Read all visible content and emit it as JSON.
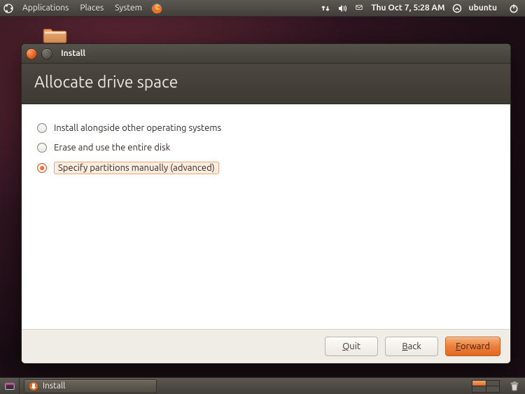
{
  "top_panel": {
    "menus": [
      "Applications",
      "Places",
      "System"
    ],
    "clock": "Thu Oct  7,  5:28 AM",
    "user": "ubuntu"
  },
  "window": {
    "title": "Install",
    "heading": "Allocate drive space",
    "options": [
      {
        "label": "Install alongside other operating systems",
        "checked": false
      },
      {
        "label": "Erase and use the entire disk",
        "checked": false
      },
      {
        "label": "Specify partitions manually (advanced)",
        "checked": true
      }
    ],
    "buttons": {
      "quit": "Quit",
      "back": "Back",
      "forward": "Forward"
    }
  },
  "bottom_panel": {
    "task": "Install"
  }
}
